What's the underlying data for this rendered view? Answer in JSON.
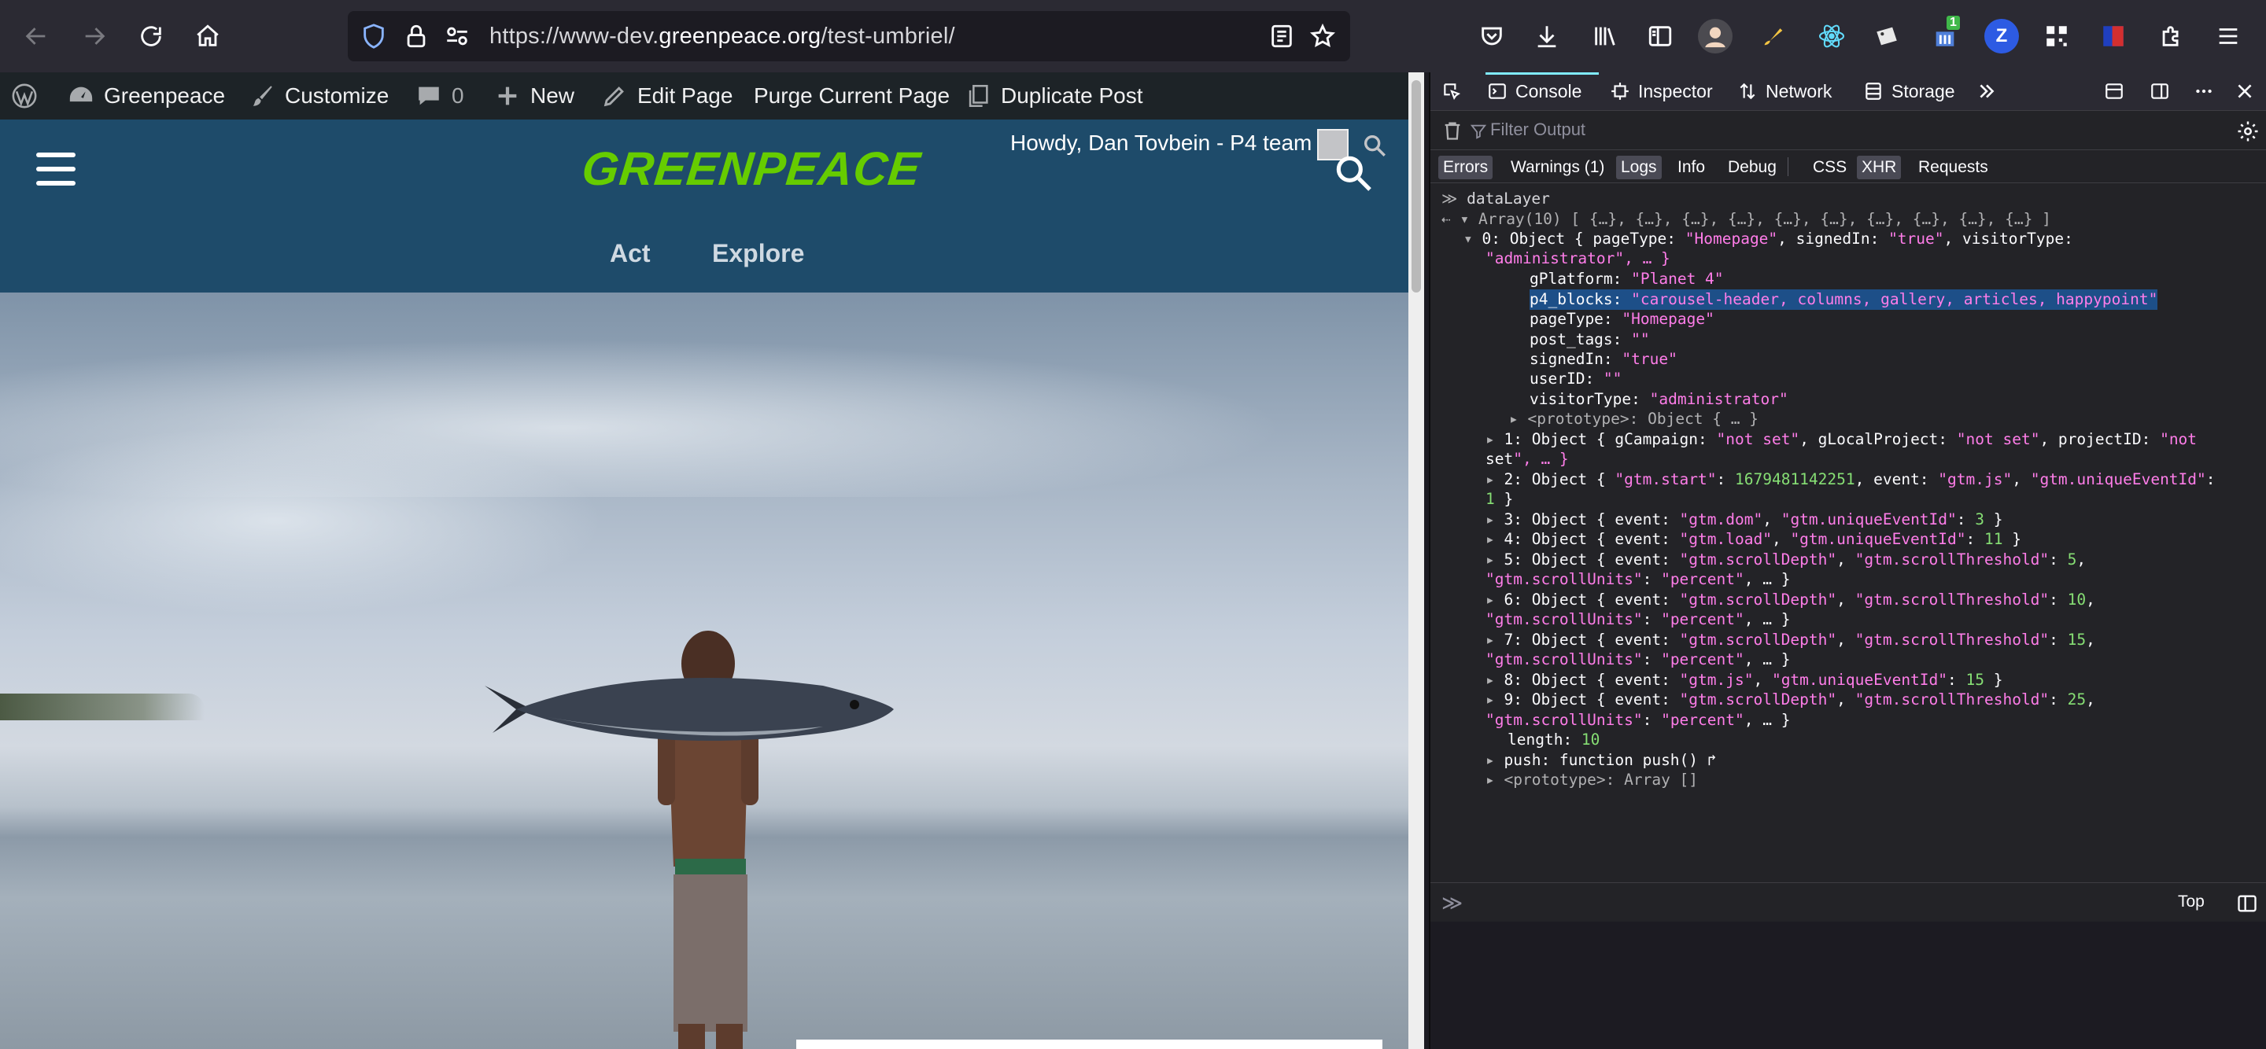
{
  "browser": {
    "url_prefix": "https://www-dev.",
    "url_domain": "greenpeace.org",
    "url_path": "/test-umbriel/",
    "ext_badge": "1",
    "ext_z": "Z"
  },
  "wp_admin_bar": {
    "site_name": "Greenpeace",
    "customize": "Customize",
    "comments_count": "0",
    "new": "New",
    "edit_page": "Edit Page",
    "purge": "Purge Current Page",
    "duplicate": "Duplicate Post"
  },
  "site": {
    "logo": "GREENPEACE",
    "howdy": "Howdy, Dan Tovbein - P4 team",
    "nav": [
      "Act",
      "Explore"
    ]
  },
  "devtools": {
    "tabs": [
      "Console",
      "Inspector",
      "Network",
      "Storage"
    ],
    "filter_placeholder": "Filter Output",
    "levels": [
      "Errors",
      "Warnings (1)",
      "Logs",
      "Info",
      "Debug",
      "CSS",
      "XHR",
      "Requests"
    ],
    "context": "Top",
    "console": {
      "input_cmd": "dataLayer",
      "array_summary": "Array(10) [ {…}, {…}, {…}, {…}, {…}, {…}, {…}, {…}, {…}, {…} ]",
      "item0_header_a": "0: Object { pageType: \"Homepage\", signedIn: \"true\", visitorType:",
      "item0_header_b": "\"administrator\", … }",
      "props": [
        "gPlatform: \"Planet 4\"",
        "p4_blocks: \"carousel-header, columns, gallery, articles, happypoint\"",
        "pageType: \"Homepage\"",
        "post_tags: \"\"",
        "signedIn: \"true\"",
        "userID: \"\"",
        "visitorType: \"administrator\"",
        "<prototype>: Object { … }"
      ],
      "items": [
        "1: Object { gCampaign: \"not set\", gLocalProject: \"not set\", projectID: \"not",
        "set\", … }",
        "2: Object { \"gtm.start\": 1679481142251, event: \"gtm.js\", \"gtm.uniqueEventId\":",
        "1 }",
        "3: Object { event: \"gtm.dom\", \"gtm.uniqueEventId\": 3 }",
        "4: Object { event: \"gtm.load\", \"gtm.uniqueEventId\": 11 }",
        "5: Object { event: \"gtm.scrollDepth\", \"gtm.scrollThreshold\": 5,",
        "\"gtm.scrollUnits\": \"percent\", … }",
        "6: Object { event: \"gtm.scrollDepth\", \"gtm.scrollThreshold\": 10,",
        "\"gtm.scrollUnits\": \"percent\", … }",
        "7: Object { event: \"gtm.scrollDepth\", \"gtm.scrollThreshold\": 15,",
        "\"gtm.scrollUnits\": \"percent\", … }",
        "8: Object { event: \"gtm.js\", \"gtm.uniqueEventId\": 15 }",
        "9: Object { event: \"gtm.scrollDepth\", \"gtm.scrollThreshold\": 25,",
        "\"gtm.scrollUnits\": \"percent\", … }",
        "length: 10",
        "push: function push() ↱",
        "<prototype>: Array []"
      ]
    }
  },
  "colors": {
    "brand_green": "#66cc00",
    "site_header": "#1e4b6a",
    "console_string": "#ff7de9",
    "console_number": "#86de74",
    "selection": "#1d4f88"
  }
}
